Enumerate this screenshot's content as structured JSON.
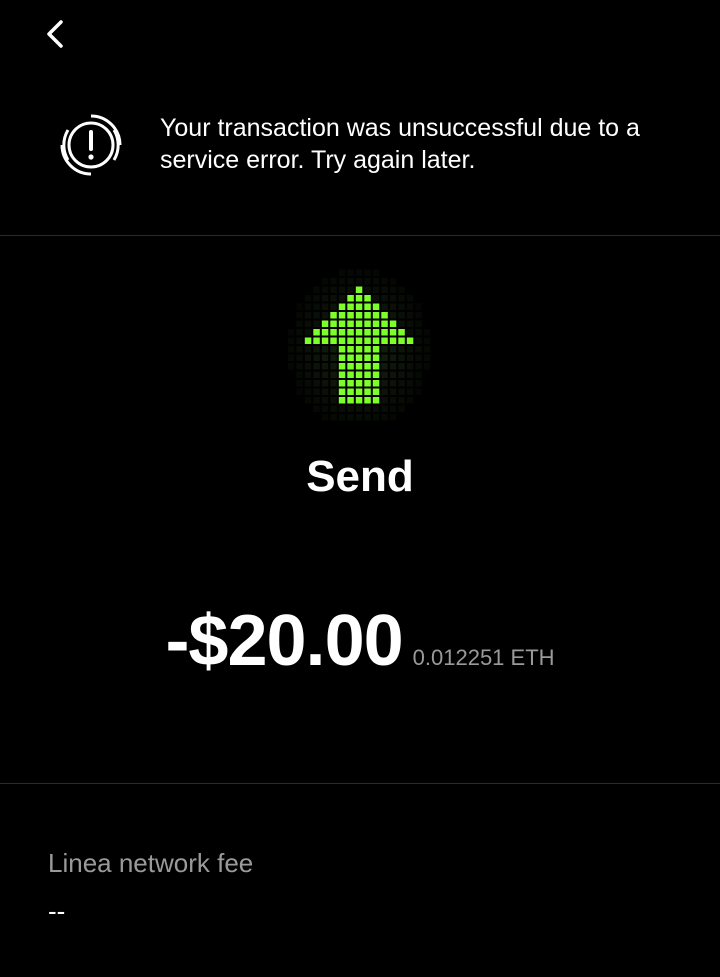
{
  "nav": {
    "back_icon": "chevron-left-icon"
  },
  "banner": {
    "icon": "alert-refresh-icon",
    "message": "Your transaction was unsuccessful due to a service error. Try again later."
  },
  "transaction": {
    "type_icon": "send-arrow-up-icon",
    "type_label": "Send",
    "amount_fiat": "-$20.00",
    "amount_crypto": "0.012251 ETH"
  },
  "fee": {
    "label": "Linea network fee",
    "value": "--"
  },
  "colors": {
    "background": "#000000",
    "text_primary": "#ffffff",
    "text_secondary": "#9a9a9a",
    "accent_green": "#7dff2a",
    "divider": "#2a2a2a"
  }
}
